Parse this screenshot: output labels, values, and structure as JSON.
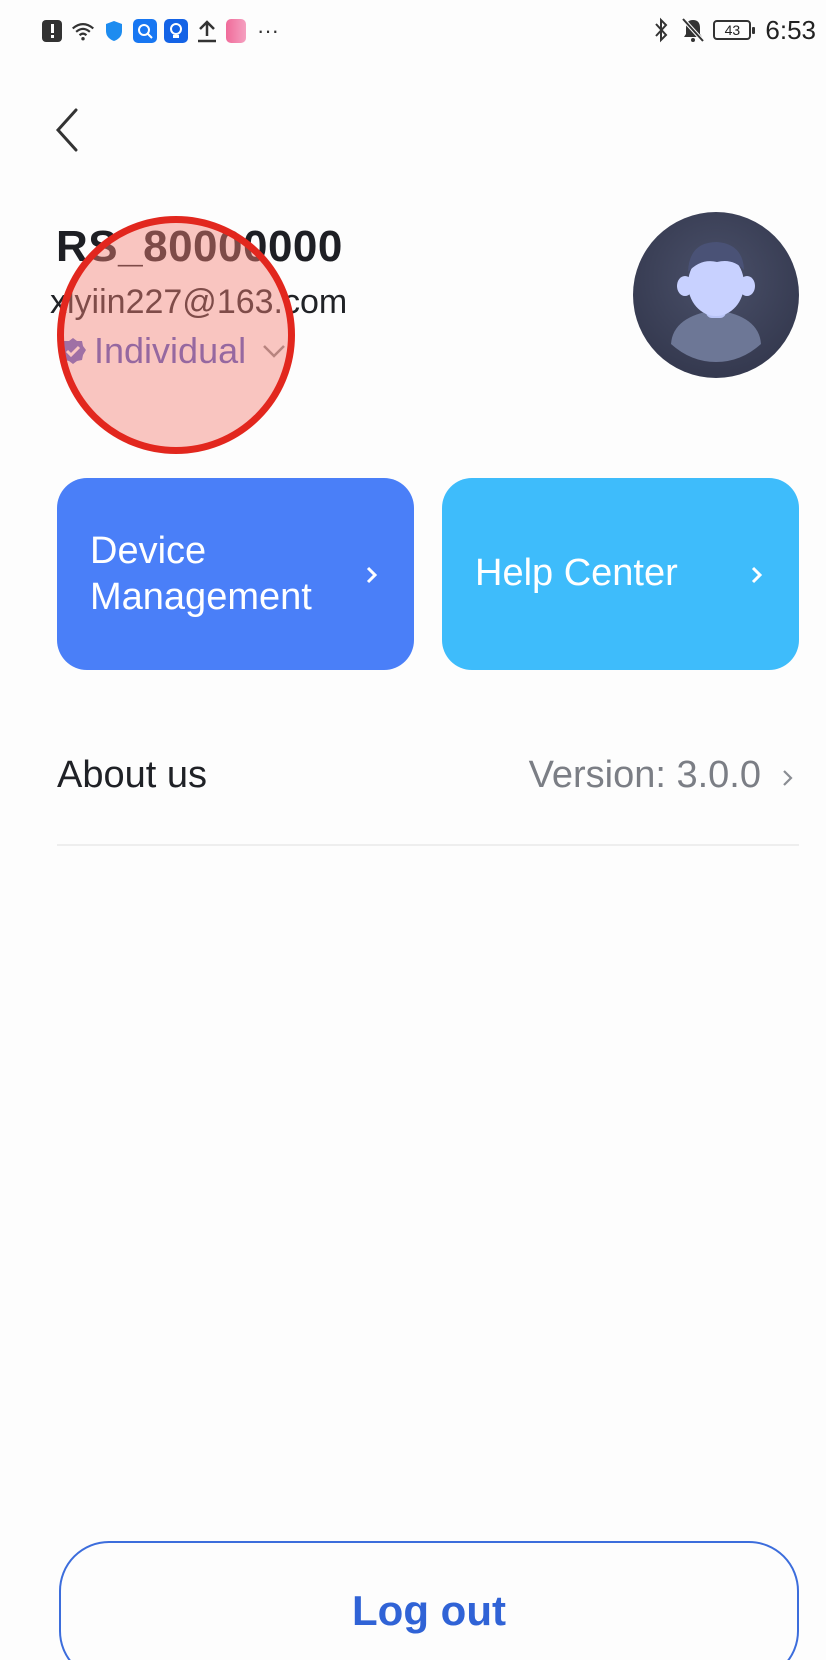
{
  "status_bar": {
    "left_icons": [
      "alert-icon",
      "wifi-icon",
      "shield-icon",
      "search-app-icon",
      "bulb-app-icon",
      "upload-icon",
      "book-app-icon"
    ],
    "more": "···",
    "battery": "43",
    "time": "6:53"
  },
  "profile": {
    "username": "RS_80000000",
    "email": "xlyiin227@163.com",
    "account_type": "Individual"
  },
  "cards": {
    "device_management": "Device Management",
    "help_center": "Help Center"
  },
  "about": {
    "label": "About us",
    "version": "Version:  3.0.0"
  },
  "logout_label": "Log out",
  "colors": {
    "device_card": "#4a7ff8",
    "help_card": "#3ebcfb",
    "account_type": "#4a55c4",
    "logout": "#3063d6",
    "highlight": "#e2271e"
  }
}
